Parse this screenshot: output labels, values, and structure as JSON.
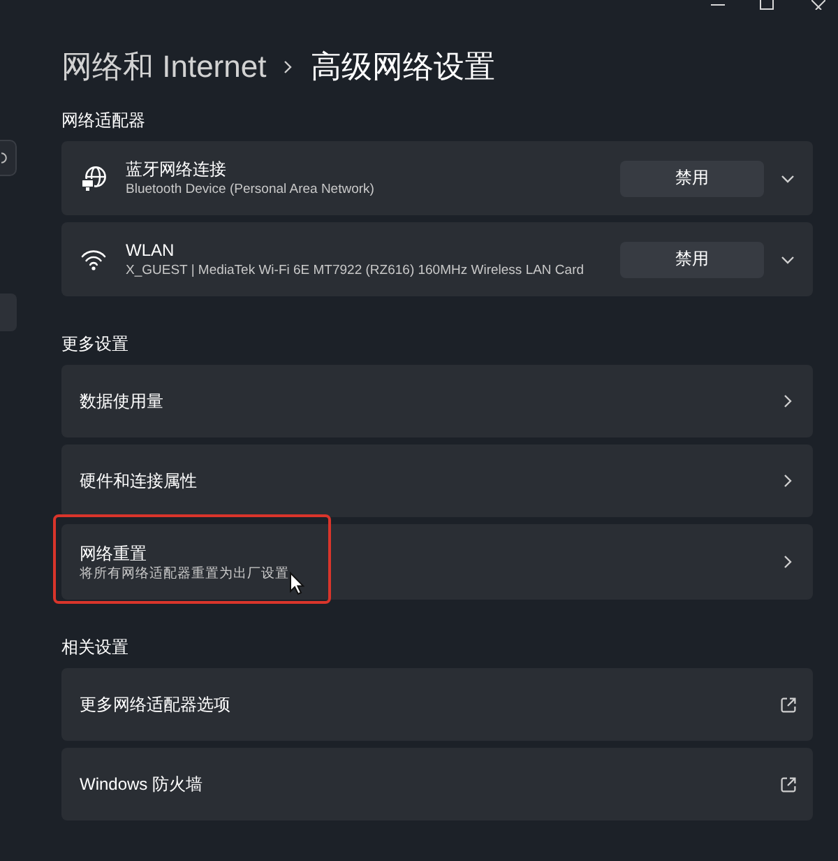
{
  "breadcrumb": [
    {
      "label": "网络和 Internet"
    },
    {
      "label": "高级网络设置"
    }
  ],
  "sections": [
    {
      "kind": "adapters",
      "heading": "网络适配器",
      "items": [
        {
          "kind": "network",
          "name": "蓝牙网络连接",
          "description": "Bluetooth Device (Personal Area Network)",
          "button": "禁用",
          "expanded": false
        },
        {
          "kind": "wifi",
          "name": "WLAN",
          "description": "X_GUEST | MediaTek Wi-Fi 6E MT7922 (RZ616) 160MHz Wireless LAN Card",
          "button": "禁用",
          "expanded": false
        }
      ]
    },
    {
      "kind": "settings",
      "heading": "更多设置",
      "items": [
        {
          "kind": "link",
          "label": "数据使用量",
          "highlighted": false,
          "hovered": false
        },
        {
          "kind": "link",
          "label": "硬件和连接属性",
          "highlighted": false,
          "hovered": false
        },
        {
          "kind": "link",
          "label": "网络重置",
          "description": "将所有网络适配器重置为出厂设置",
          "highlighted": true,
          "hovered": true
        }
      ]
    },
    {
      "kind": "settings",
      "heading": "相关设置",
      "items": [
        {
          "kind": "external",
          "label": "更多网络适配器选项",
          "highlighted": false,
          "hovered": false
        },
        {
          "kind": "external",
          "label": "Windows 防火墙",
          "highlighted": false,
          "hovered": false
        }
      ]
    }
  ]
}
